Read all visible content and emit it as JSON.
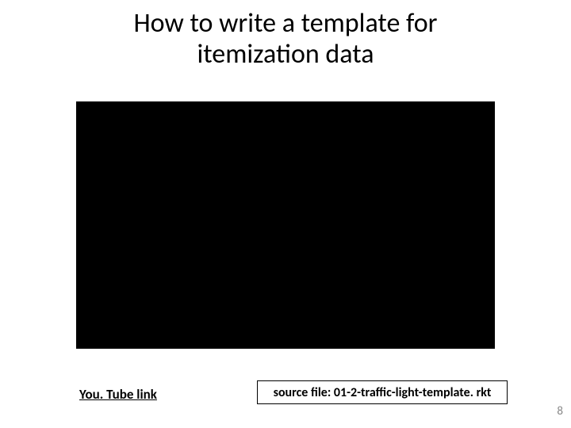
{
  "title": "How to write a template for\nitemization data",
  "link_label": "You. Tube link",
  "source_label": "source file: 01-2-traffic-light-template. rkt",
  "page_number": "8"
}
